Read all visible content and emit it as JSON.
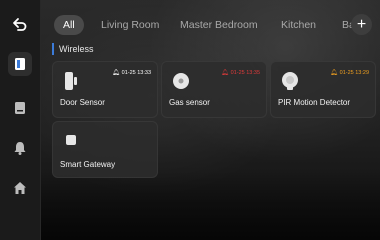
{
  "sidebar": {
    "items": [
      {
        "name": "back-arrow-icon"
      },
      {
        "name": "device-panel-icon",
        "active": true
      },
      {
        "name": "tablet-icon"
      },
      {
        "name": "bell-icon"
      },
      {
        "name": "home-icon"
      }
    ]
  },
  "tabs": [
    {
      "label": "All",
      "active": true
    },
    {
      "label": "Living Room"
    },
    {
      "label": "Master Bedroom"
    },
    {
      "label": "Kitchen"
    },
    {
      "label": "Ba"
    }
  ],
  "add_button": {
    "label": "+"
  },
  "section": {
    "title": "Wireless"
  },
  "devices": [
    {
      "name": "Door Sensor",
      "status_time": "01-25 13:33",
      "status_color": "#ffffff",
      "icon": "door-sensor-icon"
    },
    {
      "name": "Gas sensor",
      "status_time": "01-25 13:35",
      "status_color": "#e03a3a",
      "icon": "gas-sensor-icon"
    },
    {
      "name": "PIR Motion Detector",
      "status_time": "01-25 13:29",
      "status_color": "#f0a020",
      "icon": "motion-detector-icon"
    },
    {
      "name": "Smart Gateway",
      "status_time": "",
      "status_color": "",
      "icon": "gateway-icon"
    }
  ]
}
